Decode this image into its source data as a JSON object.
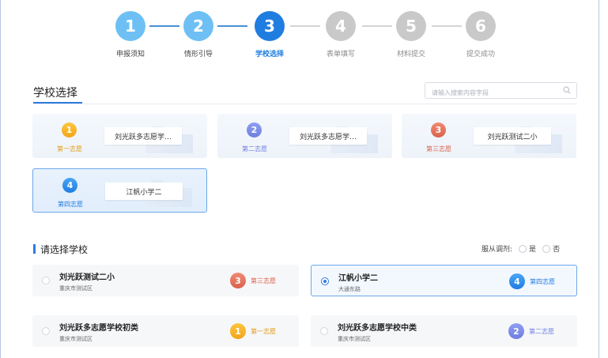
{
  "stepper": {
    "steps": [
      {
        "num": "1",
        "label": "申报须知",
        "state": "done"
      },
      {
        "num": "2",
        "label": "情形引导",
        "state": "done"
      },
      {
        "num": "3",
        "label": "学校选择",
        "state": "active"
      },
      {
        "num": "4",
        "label": "表单填写",
        "state": "todo"
      },
      {
        "num": "5",
        "label": "材料提交",
        "state": "todo"
      },
      {
        "num": "6",
        "label": "提交成功",
        "state": "todo"
      }
    ]
  },
  "section": {
    "title": "学校选择",
    "search_placeholder": "请输入搜索内容字段"
  },
  "choices": [
    {
      "num": "1",
      "pref": "第一志愿",
      "school": "刘光跃多志愿学…",
      "color": "orange",
      "selected": false
    },
    {
      "num": "2",
      "pref": "第二志愿",
      "school": "刘光跃多志愿学…",
      "color": "purple",
      "selected": false
    },
    {
      "num": "3",
      "pref": "第三志愿",
      "school": "刘光跃测试二小",
      "color": "red",
      "selected": false
    },
    {
      "num": "4",
      "pref": "第四志愿",
      "school": "江帆小学二",
      "color": "blue",
      "selected": true
    }
  ],
  "list": {
    "title": "请选择学校",
    "adjust_label": "服从调剂:",
    "adjust_yes": "是",
    "adjust_no": "否",
    "schools": [
      {
        "name": "刘光跃测试二小",
        "addr": "重庆市测试区",
        "pnum": "3",
        "ptext": "第三志愿",
        "color": "red",
        "selected": false
      },
      {
        "name": "江帆小学二",
        "addr": "大通东路",
        "pnum": "4",
        "ptext": "第四志愿",
        "color": "blue",
        "selected": true
      },
      {
        "name": "刘光跃多志愿学校初类",
        "addr": "重庆市测试区",
        "pnum": "1",
        "ptext": "第一志愿",
        "color": "orange",
        "selected": false
      },
      {
        "name": "刘光跃多志愿学校中类",
        "addr": "重庆市测试区",
        "pnum": "2",
        "ptext": "第二志愿",
        "color": "purple",
        "selected": false
      }
    ]
  }
}
